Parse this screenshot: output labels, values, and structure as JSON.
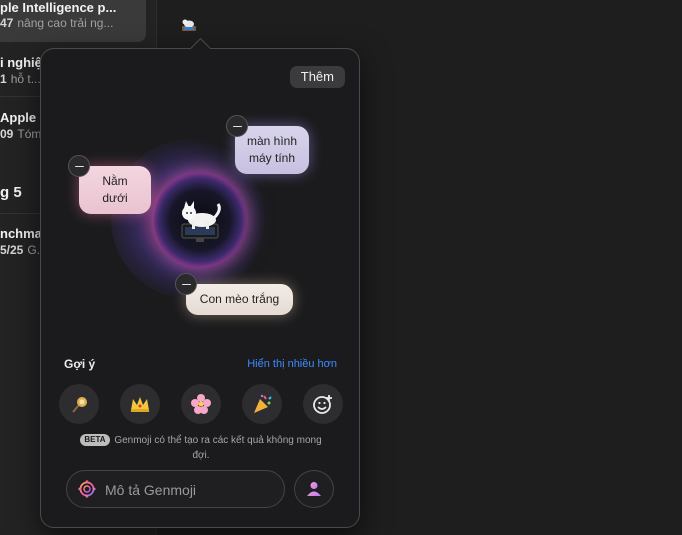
{
  "sidebar": {
    "items": [
      {
        "title": "ple Intelligence p...",
        "num": "47",
        "snippet": "nâng cao trải ng..."
      },
      {
        "title": "i nghiệ...",
        "num": "1",
        "snippet": "hỗ t..."
      },
      {
        "title": "Apple ...",
        "num": "09",
        "snippet": "Tóm..."
      }
    ],
    "section_heading": "g 5",
    "items_after": [
      {
        "title": "nchma...",
        "num": "5/25",
        "snippet": "G..."
      }
    ]
  },
  "popover": {
    "add_button": "Thêm",
    "chips": [
      {
        "line1": "Nằm",
        "line2": "dưới"
      },
      {
        "line1": "màn hình",
        "line2": "máy tính"
      },
      {
        "line1": "Con mèo trắng",
        "line2": ""
      }
    ],
    "suggestions_label": "Gợi ý",
    "show_more": "Hiển thị nhiều hơn",
    "suggestions": [
      {
        "icon": "staff-icon",
        "emoji": "🪄"
      },
      {
        "icon": "crown-icon",
        "emoji": "👑"
      },
      {
        "icon": "cherry-blossom-icon",
        "emoji": "🌸"
      },
      {
        "icon": "party-popper-icon",
        "emoji": "🎉"
      },
      {
        "icon": "emoji-add-icon",
        "emoji": "😀"
      }
    ],
    "beta_badge": "BETA",
    "beta_note": "Genmoji có thể tạo ra các kết quả không mong đợi.",
    "input_placeholder": "Mô tả Genmoji"
  },
  "colors": {
    "accent_link": "#3d8bff",
    "popover_bg": "#1b1b1d"
  }
}
